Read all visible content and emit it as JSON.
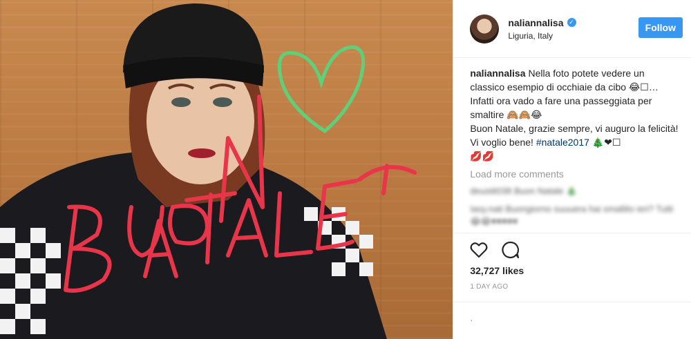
{
  "colors": {
    "accent": "#3897f0",
    "text": "#262626",
    "muted": "#999999",
    "hashtag": "#003569",
    "divider": "#efefef",
    "scribble_red": "#e8354a",
    "scribble_green": "#5fd07a"
  },
  "photo": {
    "scribble_heart": "green heart drawing",
    "scribble_text": "BUON NATALE"
  },
  "header": {
    "username": "naliannalisa",
    "verified_icon": "verified-badge-icon",
    "location": "Liguria, Italy",
    "follow_label": "Follow"
  },
  "caption": {
    "username": "naliannalisa",
    "line1": "Nella foto potete vedere un classico esempio di occhiaie da cibo 😂☐…",
    "line2": "Infatti ora vado a fare una passeggiata per smaltire 🙈🙈😂",
    "line3": "Buon Natale, grazie sempre, vi auguro la felicità! Vi voglio bene!",
    "hashtag": "#natale2017",
    "line3_end": "🎄❤☐",
    "line4": "💋💋"
  },
  "load_more": "Load more comments",
  "blurred_comments": [
    "deustit038 Buon Natale 🎄",
    "Iasy.nati Buongiorno suuuera hai smaltito ieri? Tutti 😂😂♥♥♥♥♥"
  ],
  "actions": {
    "like_icon": "heart-outline-icon",
    "comment_icon": "comment-bubble-icon"
  },
  "likes": "32,727 likes",
  "time_ago": "1 DAY AGO",
  "add_comment_placeholder": "."
}
